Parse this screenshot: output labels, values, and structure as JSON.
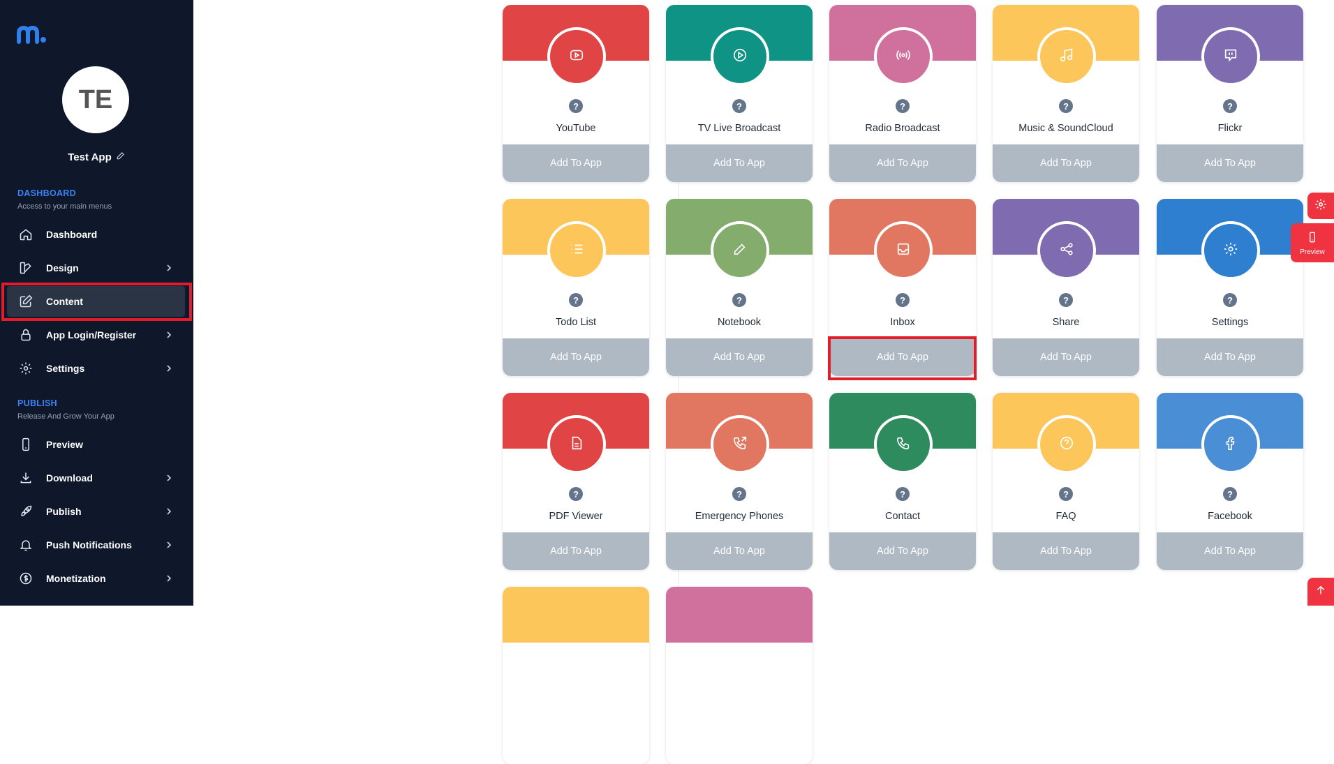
{
  "sidebar": {
    "avatar_initials": "TE",
    "app_name": "Test App",
    "dashboard_section": {
      "title": "DASHBOARD",
      "subtitle": "Access to your main menus"
    },
    "publish_section": {
      "title": "PUBLISH",
      "subtitle": "Release And Grow Your App"
    },
    "items": [
      {
        "label": "Dashboard",
        "icon": "home-icon"
      },
      {
        "label": "Design",
        "icon": "palette-icon"
      },
      {
        "label": "Content",
        "icon": "edit-icon"
      },
      {
        "label": "App Login/Register",
        "icon": "lock-icon"
      },
      {
        "label": "Settings",
        "icon": "gear-icon"
      },
      {
        "label": "Preview",
        "icon": "phone-icon"
      },
      {
        "label": "Download",
        "icon": "download-icon"
      },
      {
        "label": "Publish",
        "icon": "rocket-icon"
      },
      {
        "label": "Push Notifications",
        "icon": "bell-icon"
      },
      {
        "label": "Monetization",
        "icon": "dollar-icon"
      }
    ]
  },
  "cards": [
    {
      "name": "YouTube",
      "icon": "youtube-icon",
      "top_color": "#e04444",
      "circle_color": "#e04444",
      "button": "Add To App"
    },
    {
      "name": "TV Live Broadcast",
      "icon": "play-icon",
      "top_color": "#0e9384",
      "circle_color": "#0e9384",
      "button": "Add To App"
    },
    {
      "name": "Radio Broadcast",
      "icon": "radio-icon",
      "top_color": "#d0709c",
      "circle_color": "#d0709c",
      "button": "Add To App"
    },
    {
      "name": "Music & SoundCloud",
      "icon": "music-icon",
      "top_color": "#fdc65a",
      "circle_color": "#fdc65a",
      "button": "Add To App"
    },
    {
      "name": "Flickr",
      "icon": "flickr-icon",
      "top_color": "#7e6bb0",
      "circle_color": "#7e6bb0",
      "button": "Add To App"
    },
    {
      "name": "Todo List",
      "icon": "list-icon",
      "top_color": "#fdc65a",
      "circle_color": "#fdc65a",
      "button": "Add To App"
    },
    {
      "name": "Notebook",
      "icon": "pencil-icon",
      "top_color": "#84ac6c",
      "circle_color": "#84ac6c",
      "button": "Add To App"
    },
    {
      "name": "Inbox",
      "icon": "inbox-icon",
      "top_color": "#e27761",
      "circle_color": "#e27761",
      "button": "Add To App"
    },
    {
      "name": "Share",
      "icon": "share-icon",
      "top_color": "#7e6bb0",
      "circle_color": "#7e6bb0",
      "button": "Add To App"
    },
    {
      "name": "Settings",
      "icon": "gear-icon",
      "top_color": "#2f7fd0",
      "circle_color": "#2f7fd0",
      "button": "Add To App"
    },
    {
      "name": "PDF Viewer",
      "icon": "document-icon",
      "top_color": "#e04444",
      "circle_color": "#e04444",
      "button": "Add To App"
    },
    {
      "name": "Emergency Phones",
      "icon": "phone-outgoing-icon",
      "top_color": "#e27761",
      "circle_color": "#e27761",
      "button": "Add To App"
    },
    {
      "name": "Contact",
      "icon": "phone-icon",
      "top_color": "#2e8b5e",
      "circle_color": "#2e8b5e",
      "button": "Add To App"
    },
    {
      "name": "FAQ",
      "icon": "question-icon",
      "top_color": "#fdc65a",
      "circle_color": "#fdc65a",
      "button": "Add To App"
    },
    {
      "name": "Facebook",
      "icon": "facebook-icon",
      "top_color": "#4a8fd6",
      "circle_color": "#4a8fd6",
      "button": "Add To App"
    }
  ],
  "partial_cards": [
    {
      "top_color": "#fdc65a"
    },
    {
      "top_color": "#d0709c"
    }
  ],
  "floating": {
    "preview_label": "Preview"
  },
  "accent": "#ef3340"
}
